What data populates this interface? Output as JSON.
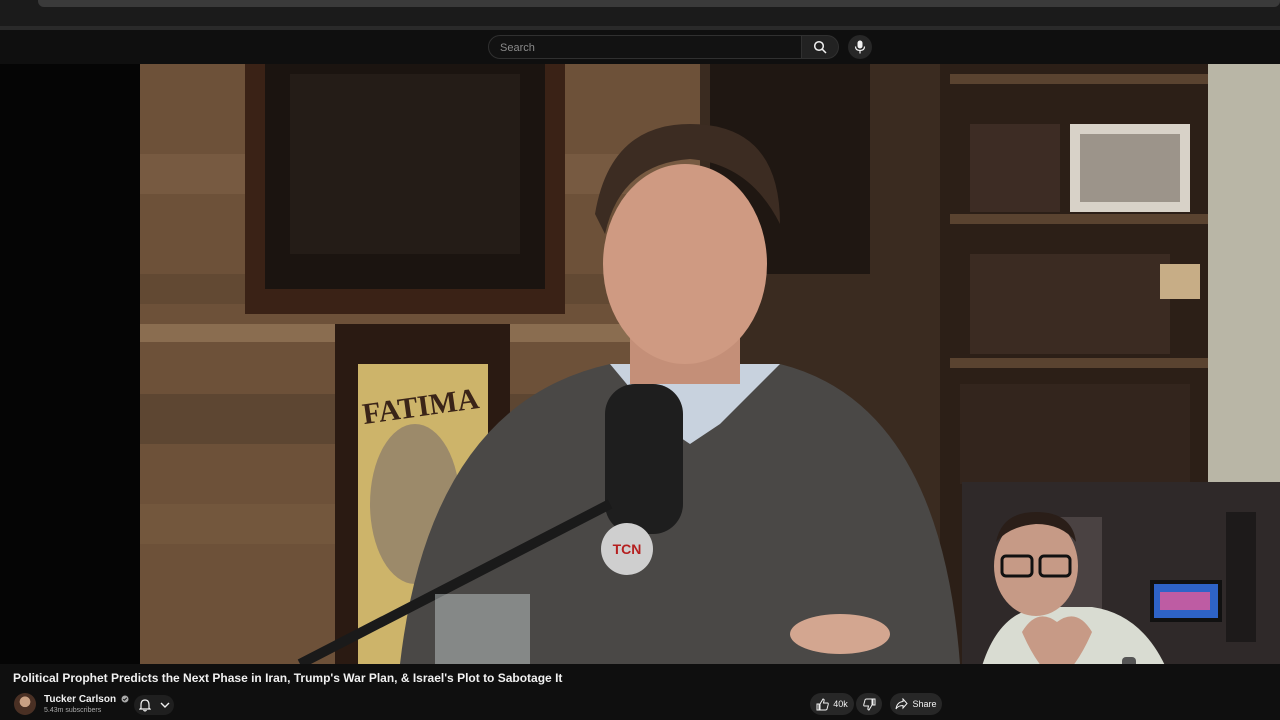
{
  "search": {
    "placeholder": "Search"
  },
  "video": {
    "mic_logo": "TCN",
    "poster_text": "FATIMA"
  },
  "title": "Political Prophet Predicts the Next Phase in Iran, Trump's War Plan, & Israel's Plot to Sabotage It",
  "channel": {
    "name": "Tucker Carlson",
    "subscribers": "5.43m subscribers"
  },
  "actions": {
    "likes": "40k",
    "share_label": "Share"
  },
  "icons": [
    "search-icon",
    "mic-icon",
    "verified-icon",
    "bell-icon",
    "chevron-down-icon",
    "like-icon",
    "dislike-icon",
    "share-icon"
  ]
}
